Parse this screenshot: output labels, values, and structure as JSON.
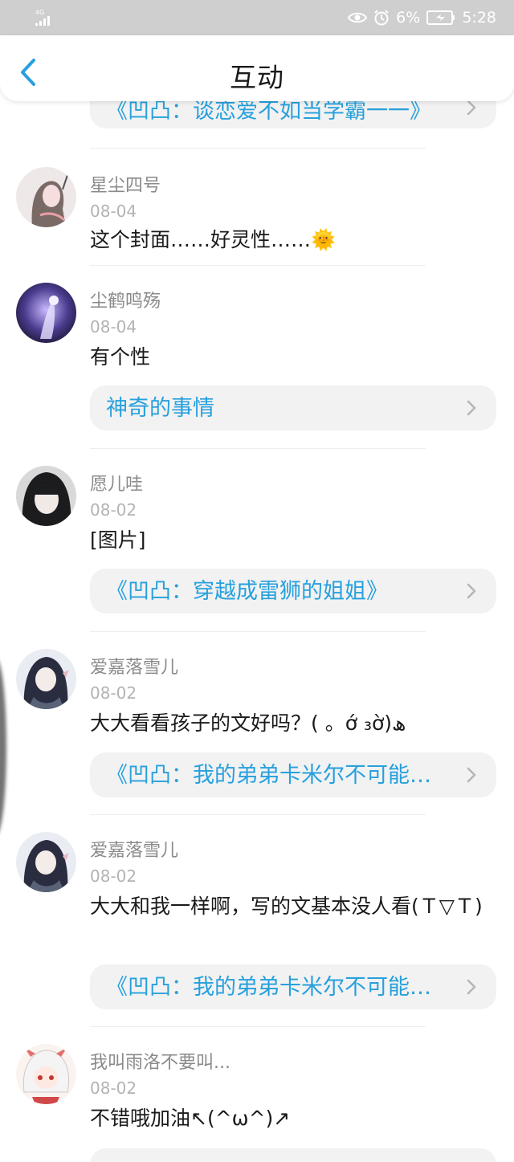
{
  "status_bar": {
    "network": "4G",
    "battery_percent": "6%",
    "time": "5:28",
    "icons": [
      "signal-icon",
      "eye-icon",
      "alarm-icon",
      "battery-charging-icon"
    ]
  },
  "header": {
    "title": "互动",
    "back_icon": "chevron-left-icon"
  },
  "top_link": {
    "text": "《凹凸：谈恋爱不如当学霸一一》"
  },
  "comments": [
    {
      "user": "星尘四号",
      "date": "08-04",
      "text": "这个封面……好灵性……🌞"
    },
    {
      "user": "尘鹤鸣殇",
      "date": "08-04",
      "text": "有个性",
      "link": "神奇的事情"
    },
    {
      "user": "愿儿哇",
      "date": "08-02",
      "text": "[图片]",
      "link": "《凹凸：穿越成雷狮的姐姐》"
    },
    {
      "user": "爱嘉落雪儿",
      "date": "08-02",
      "text": "大大看看孩子的文好吗？( 。ớ ₃ờ)ھ",
      "link": "《凹凸：我的弟弟卡米尔不可能…"
    },
    {
      "user": "爱嘉落雪儿",
      "date": "08-02",
      "text": "大大和我一样啊，写的文基本没人看(Ｔ▽Ｔ)",
      "link": "《凹凸：我的弟弟卡米尔不可能…"
    },
    {
      "user": "我叫雨洛不要叫...",
      "date": "08-02",
      "text": "不错哦加油↖(^ω^)↗"
    }
  ],
  "colors": {
    "accent_link": "#27a0dd",
    "back_arrow": "#2a9fe0",
    "status_bar_bg": "#cfcfcf"
  }
}
